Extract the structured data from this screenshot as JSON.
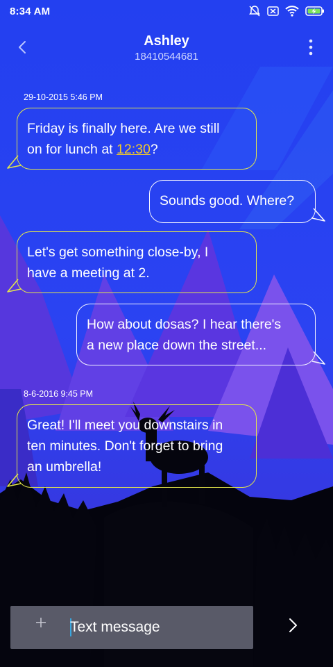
{
  "status_bar": {
    "time": "8:34 AM",
    "icons": [
      "silent-alarm-icon",
      "no-sim-icon",
      "wifi-icon",
      "battery-charging-icon"
    ]
  },
  "header": {
    "contact_name": "Ashley",
    "contact_number": "18410544681",
    "back_icon": "chevron-left-icon",
    "more_icon": "more-vertical-icon"
  },
  "conversation": {
    "timestamps": [
      "29-10-2015 5:46 PM",
      "8-6-2016 9:45 PM"
    ],
    "messages": [
      {
        "direction": "incoming",
        "line1": "Friday is finally here. Are we still",
        "line2_prefix": "on for lunch at ",
        "line2_link": "12:30",
        "line2_suffix": "?"
      },
      {
        "direction": "outgoing",
        "text": "Sounds good. Where?"
      },
      {
        "direction": "incoming",
        "line1": "Let's get something close-by, I",
        "line2": "have a meeting at 2."
      },
      {
        "direction": "outgoing",
        "line1": "How about dosas? I hear there's",
        "line2": "a new place down the street..."
      },
      {
        "direction": "incoming",
        "line1": "Great! I'll meet you downstairs in",
        "line2": "ten minutes. Don't forget to bring",
        "line3": "an umbrella!"
      }
    ]
  },
  "composer": {
    "placeholder": "Text message",
    "attach_icon": "plus-icon",
    "send_icon": "chevron-right-icon"
  },
  "colors": {
    "background": "#1f3df0",
    "incoming_border": "#e4e74a",
    "outgoing_border": "#f4f4ff",
    "link": "#f1c92b",
    "composer": "#595a68"
  }
}
